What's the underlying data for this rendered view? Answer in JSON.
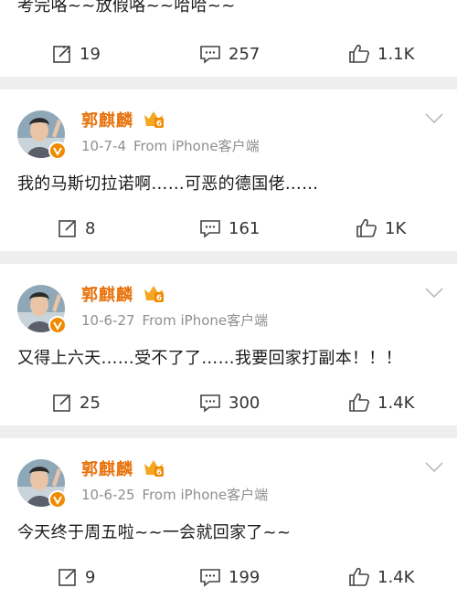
{
  "posts": [
    {
      "text": "考完咯~~放假咯~~哈哈~~",
      "reposts": "19",
      "comments": "257",
      "likes": "1.1K"
    },
    {
      "username": "郭麒麟",
      "date": "10-7-4",
      "source": "From iPhone客户端",
      "text": "我的马斯切拉诺啊……可恶的德国佬……",
      "reposts": "8",
      "comments": "161",
      "likes": "1K"
    },
    {
      "username": "郭麒麟",
      "date": "10-6-27",
      "source": "From iPhone客户端",
      "text": "又得上六天……受不了了……我要回家打副本！！！",
      "reposts": "25",
      "comments": "300",
      "likes": "1.4K"
    },
    {
      "username": "郭麒麟",
      "date": "10-6-25",
      "source": "From iPhone客户端",
      "text": "今天终于周五啦~~一会就回家了~~",
      "reposts": "9",
      "comments": "199",
      "likes": "1.4K"
    }
  ],
  "badge_text": "6",
  "icons": {
    "repost": "repost-icon",
    "comment": "comment-icon",
    "like": "like-icon",
    "more": "chevron-down-icon",
    "verified": "verified-badge-icon",
    "vip": "vip-crown-icon"
  },
  "colors": {
    "username": "#e8720c",
    "meta": "#8f8f8f",
    "verified": "#f08a00",
    "background": "#eeeeee"
  }
}
